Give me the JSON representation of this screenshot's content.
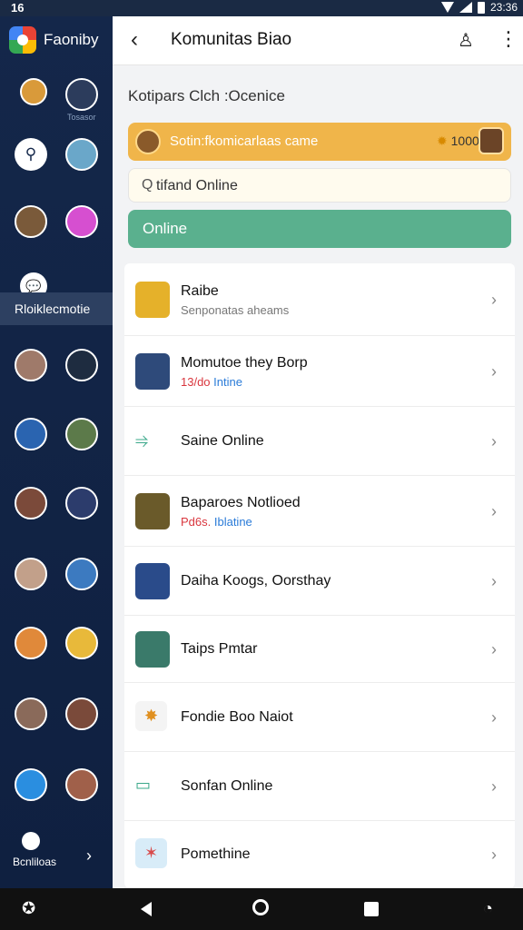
{
  "status_bar": {
    "left": "16",
    "time": "23:36"
  },
  "app": {
    "name": "Faoniby"
  },
  "sidebar": {
    "active_label": "Rloiklecmotie",
    "footer_label": "Bcnliloas",
    "avatars": [
      {
        "icon": "face-icon",
        "color": "#d99a3a"
      },
      {
        "icon": "shield-icon",
        "color": "#2c3c5c",
        "text": "Tosasor"
      },
      {
        "icon": "person-icon",
        "color": "#ffffff"
      },
      {
        "icon": "robot-icon",
        "color": "#6aa7c9"
      },
      {
        "icon": "avatar-icon",
        "color": "#7a5a3a"
      },
      {
        "icon": "gamepad-icon",
        "color": "#d64fd0"
      },
      {
        "icon": "chat-icon",
        "color": "#ffffff"
      },
      {
        "icon": "woman-icon",
        "color": "#9f7a6a"
      },
      {
        "icon": "dark-icon",
        "color": "#1e2c40"
      },
      {
        "icon": "star-icon",
        "color": "#2a64b0"
      },
      {
        "icon": "soldier-icon",
        "color": "#5c7a4a"
      },
      {
        "icon": "warrior-icon",
        "color": "#7b4a3a"
      },
      {
        "icon": "knight-icon",
        "color": "#2c3c6c"
      },
      {
        "icon": "girl-icon",
        "color": "#c2a08a"
      },
      {
        "icon": "hero-icon",
        "color": "#3c7ac0"
      },
      {
        "icon": "fighter-icon",
        "color": "#e0893a"
      },
      {
        "icon": "brawler-icon",
        "color": "#e8b93a"
      },
      {
        "icon": "lady-icon",
        "color": "#8a6a5a"
      },
      {
        "icon": "captain-icon",
        "color": "#7a4a3a"
      },
      {
        "icon": "flower-icon",
        "color": "#2a8ee0"
      },
      {
        "icon": "cowboy-icon",
        "color": "#a0604a"
      }
    ]
  },
  "topbar": {
    "title": "Komunitas Biao",
    "back": "‹",
    "more": "⋮",
    "alert": "♙"
  },
  "section": {
    "title": "Kotipars Clch :Ocenice"
  },
  "banner": {
    "text": "Sotin:fkomicarlaas came",
    "coins": "1000"
  },
  "search": {
    "value": "tifand Online"
  },
  "online_button": {
    "label": "Online"
  },
  "list": [
    {
      "name": "Raibe",
      "sub": "Senponatas aheams",
      "thumb": "#e5b12a"
    },
    {
      "name": "Momutoe they Borp",
      "sub_red": "13/do",
      "sub_blue": "Intine",
      "thumb": "#2e4a7a"
    },
    {
      "name": "Saine Online",
      "icon": "⥤"
    },
    {
      "name": "Baparoes Notlioed",
      "sub_red": "Pd6s.",
      "sub_blue": "Iblatine",
      "thumb": "#6a5a2a"
    },
    {
      "name": "Daiha Koogs, Oorsthay",
      "thumb": "#2a4b8a"
    },
    {
      "name": "Taips Pmtar",
      "thumb": "#3a7a6a"
    },
    {
      "name": "Fondie Boo Naiot",
      "icon": "✸"
    },
    {
      "name": "Sonfan Online",
      "icon": "▭"
    },
    {
      "name": "Pomethine",
      "icon": "✶"
    }
  ]
}
